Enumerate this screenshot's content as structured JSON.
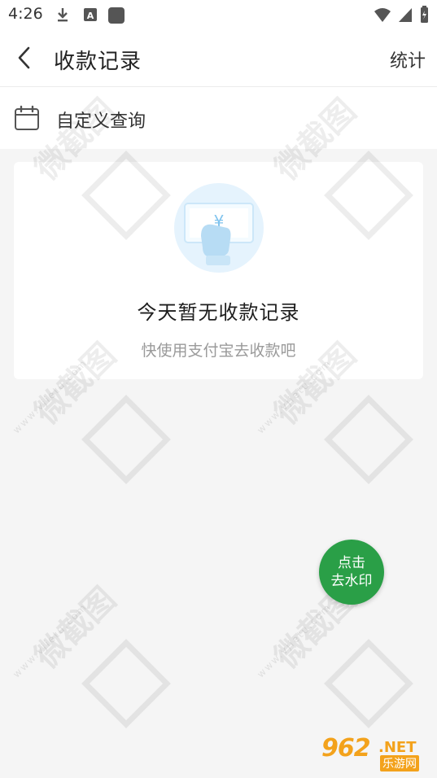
{
  "status_bar": {
    "time": "4:26"
  },
  "header": {
    "title": "收款记录",
    "right_action": "统计"
  },
  "query": {
    "label": "自定义查询"
  },
  "empty_state": {
    "currency": "¥",
    "title": "今天暂无收款记录",
    "subtitle": "快使用支付宝去收款吧"
  },
  "fab": {
    "line1": "点击",
    "line2": "去水印"
  },
  "watermark": {
    "text": "微截图",
    "url": "www.vjietu.com"
  },
  "corner_logo": {
    "number": "962",
    "suffix": ".NET",
    "cn": "乐游网"
  },
  "colors": {
    "accent_green": "#2a9f47",
    "logo_orange": "#f3a21c",
    "illustration_blue": "#dff1fd"
  }
}
